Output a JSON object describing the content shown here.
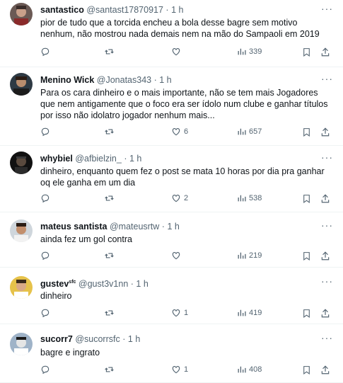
{
  "tweets": [
    {
      "name": "santastico",
      "handle": "@santast17870917",
      "dot": "·",
      "time": "1 h",
      "text": "pior de tudo que a torcida encheu a bola desse bagre sem motivo nenhum, não mostrou nada demais nem na mão do Sampaoli em 2019",
      "likes": "",
      "views": "339"
    },
    {
      "name": "Menino Wick",
      "handle": "@Jonatas343",
      "dot": "·",
      "time": "1 h",
      "text": "Para os cara dinheiro e o mais importante, não se tem mais Jogadores que nem antigamente que o foco era ser ídolo num clube e ganhar títulos por isso não idolatro jogador nenhum mais...",
      "likes": "6",
      "views": "657"
    },
    {
      "name": "whybiel",
      "handle": "@afbielzin_",
      "dot": "·",
      "time": "1 h",
      "text": "dinheiro, enquanto quem fez o post se mata 10 horas por dia pra ganhar oq ele ganha em um dia",
      "likes": "2",
      "views": "538"
    },
    {
      "name": "mateus santista",
      "handle": "@mateusrtw",
      "dot": "·",
      "time": "1 h",
      "text": "ainda fez um gol contra",
      "likes": "",
      "views": "219"
    },
    {
      "name": "gustev",
      "name_badge": "sfc",
      "handle": "@gust3v1nn",
      "dot": "·",
      "time": "1 h",
      "text": "dinheiro",
      "likes": "1",
      "views": "419"
    },
    {
      "name": "sucorr7",
      "handle": "@sucorrsfc",
      "dot": "·",
      "time": "1 h",
      "text": "bagre e ingrato",
      "likes": "1",
      "views": "408"
    }
  ],
  "icons": {
    "more": "more-horizontal-icon",
    "reply": "reply-icon",
    "retweet": "retweet-icon",
    "like": "heart-icon",
    "views": "views-bar-chart-icon",
    "bookmark": "bookmark-icon",
    "share": "share-icon"
  },
  "colors": {
    "text": "#0f1419",
    "secondary": "#536471",
    "divider": "#eff3f4"
  }
}
